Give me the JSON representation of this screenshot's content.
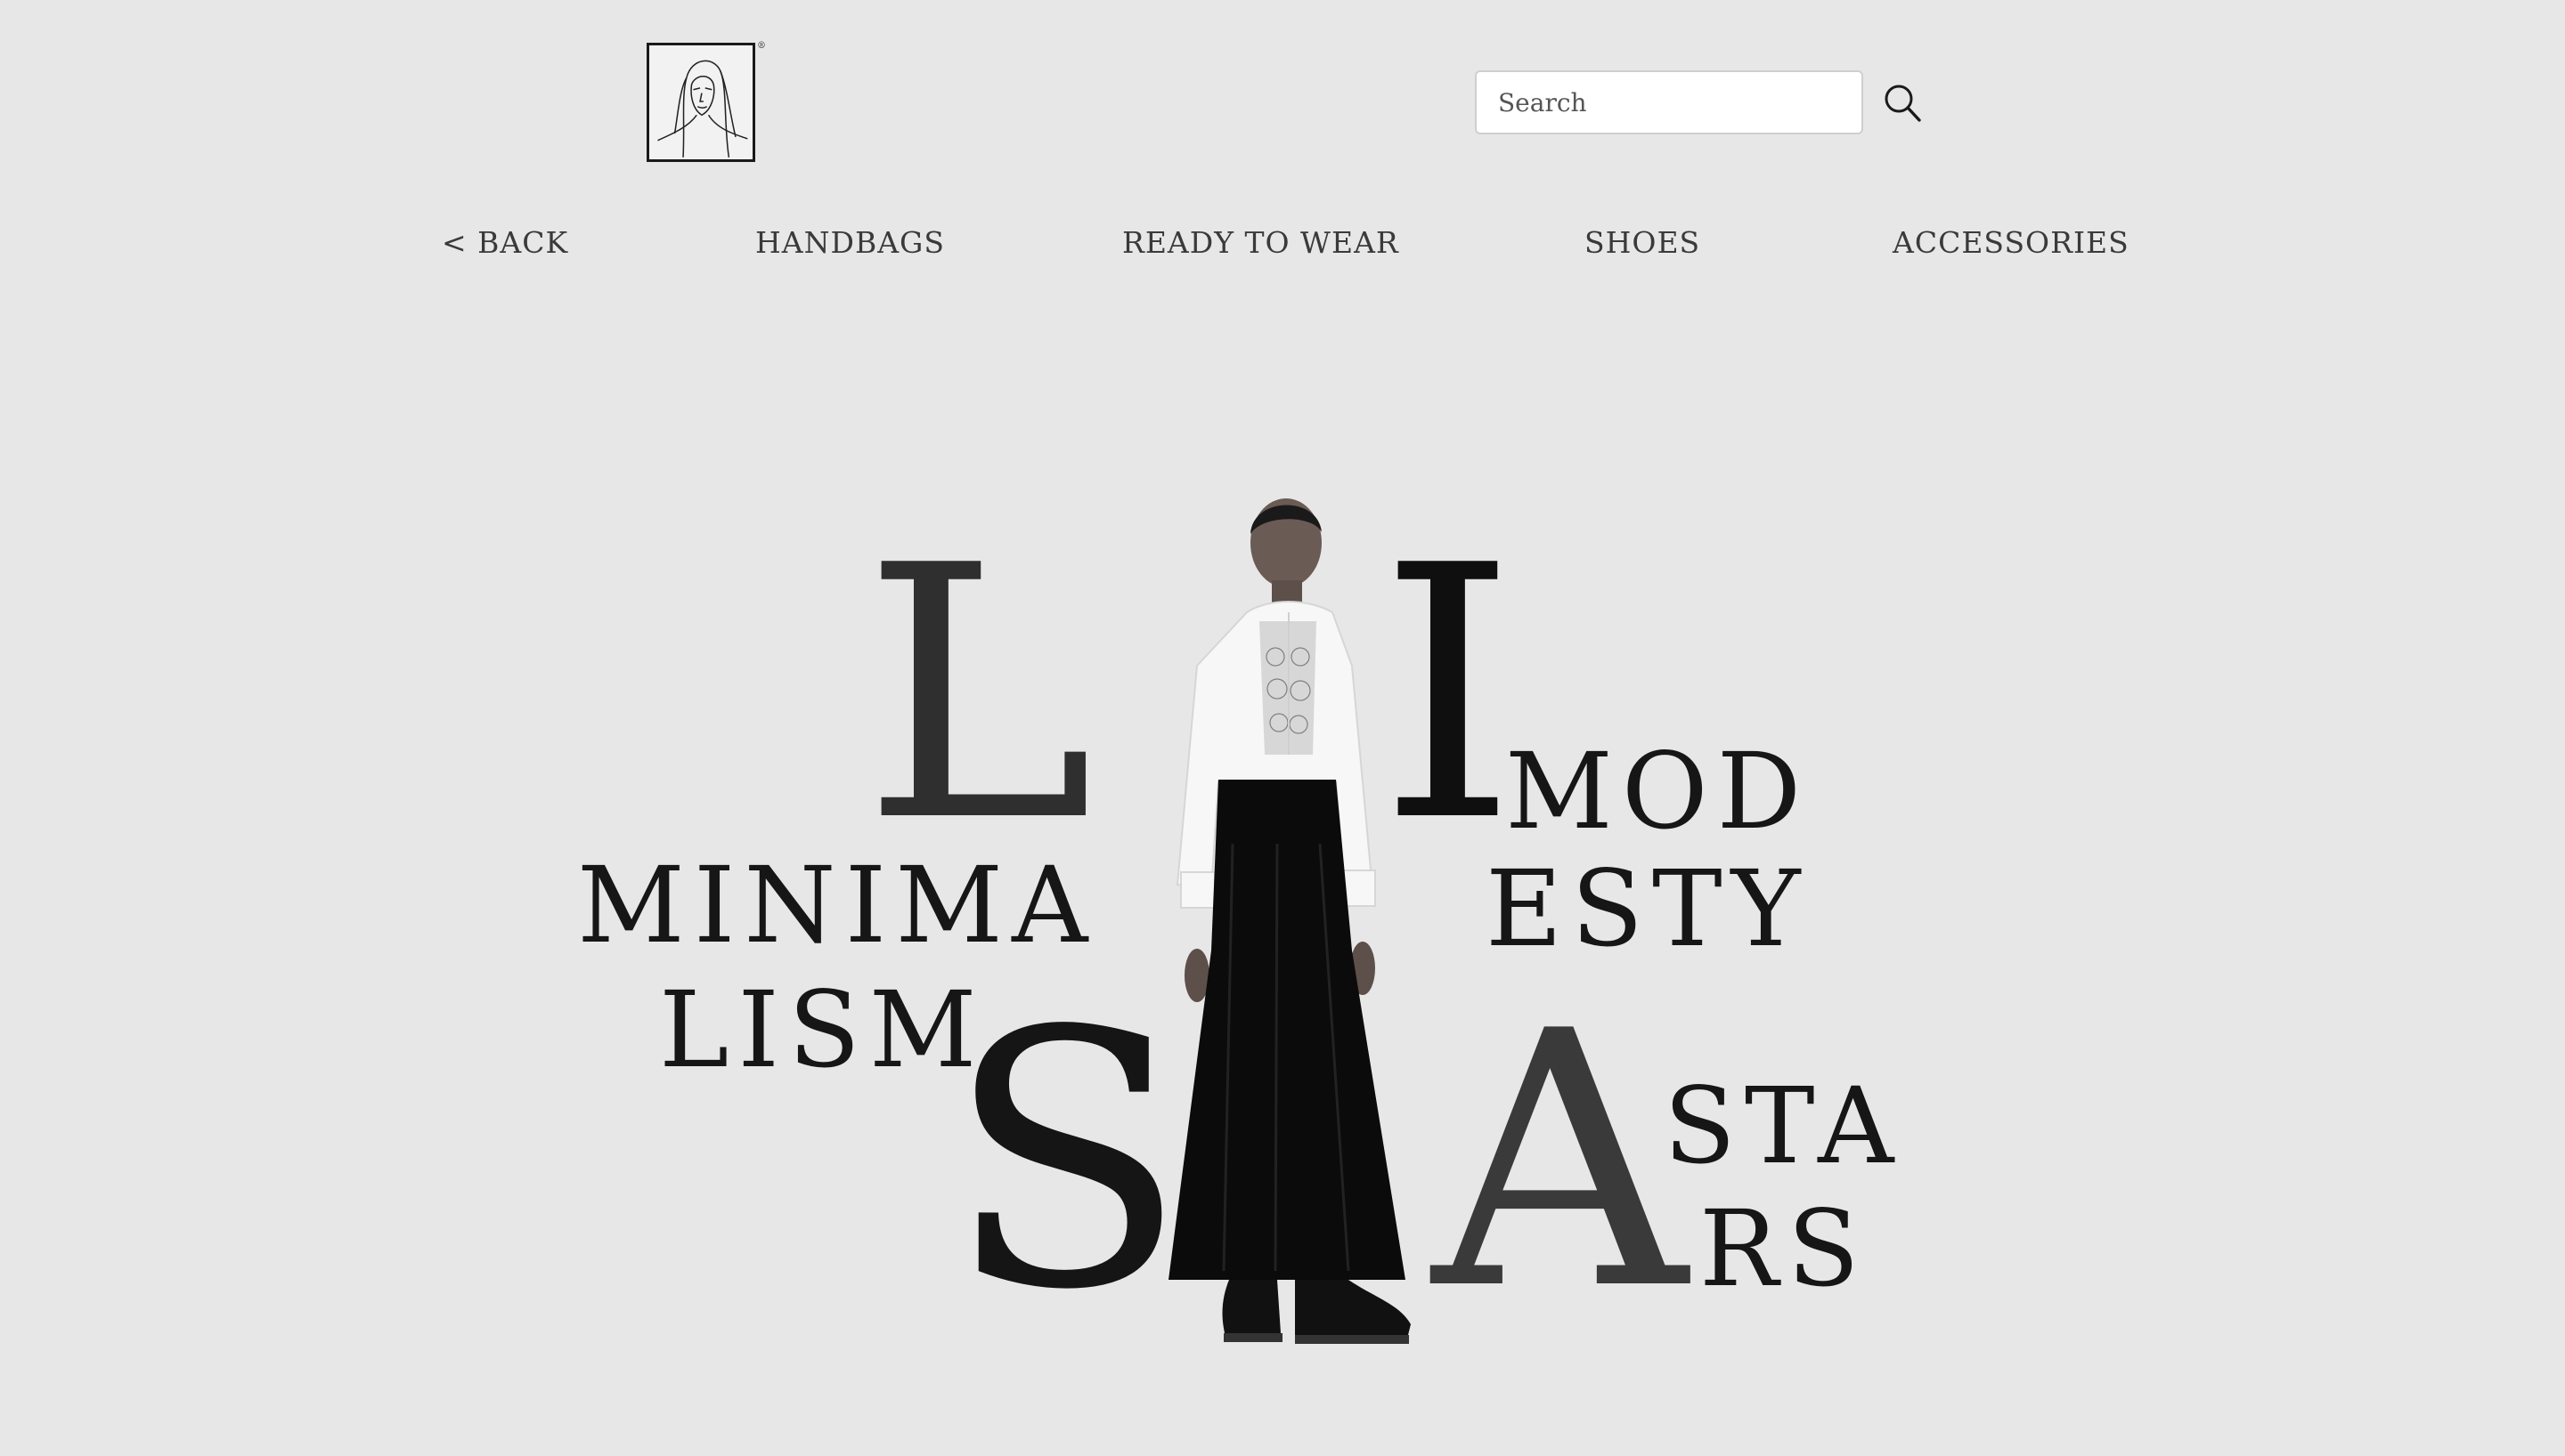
{
  "header": {
    "logo_icon": "portrait-line-drawing-logo",
    "logo_reg_mark": "®",
    "search": {
      "placeholder": "Search",
      "value": "",
      "icon": "search-icon"
    }
  },
  "nav": {
    "back": "< BACK",
    "handbags": "HANDBAGS",
    "ready_to_wear": "READY TO WEAR",
    "shoes": "SHOES",
    "accessories": "ACCESSORIES"
  },
  "hero": {
    "letters": {
      "l": "L",
      "i": "I",
      "s": "S",
      "a": "A"
    },
    "words": {
      "minima": "MINIMA",
      "lism": "LISM",
      "mod": "MOD",
      "esty": "ESTY",
      "sta": "STA",
      "rs": "RS"
    },
    "model_image": "model-in-white-blouse-and-black-skirt"
  },
  "colors": {
    "background": "#e7e7e7",
    "text": "#161616",
    "letter_dark": "#2f2f2f",
    "letter_black": "#0f0f0f"
  }
}
